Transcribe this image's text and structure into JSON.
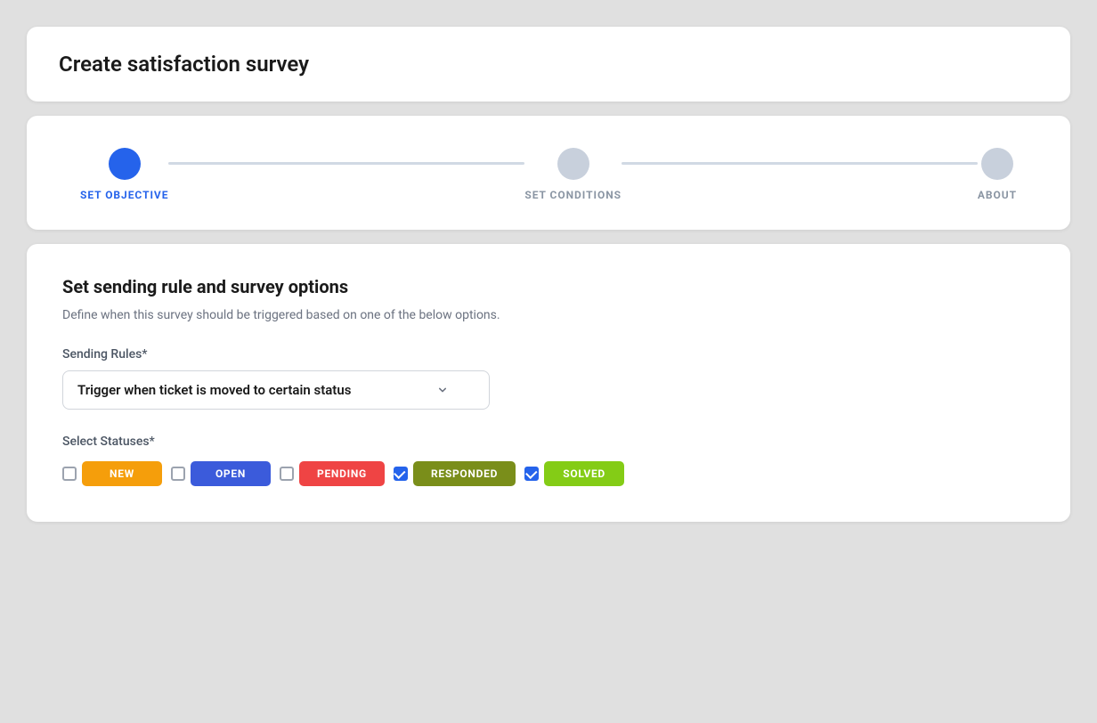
{
  "page": {
    "title": "Create satisfaction survey"
  },
  "stepper": {
    "steps": [
      {
        "id": "set-objective",
        "label": "SET OBJECTIVE",
        "state": "active"
      },
      {
        "id": "set-conditions",
        "label": "SET CONDITIONS",
        "state": "inactive"
      },
      {
        "id": "about",
        "label": "ABOUT",
        "state": "inactive"
      }
    ]
  },
  "form": {
    "section_title": "Set sending rule and survey options",
    "section_description": "Define when this survey should be triggered based on one of the below options.",
    "sending_rules_label": "Sending Rules*",
    "sending_rules_value": "Trigger when ticket is moved to certain status",
    "sending_rules_placeholder": "Trigger when ticket is moved to certain status",
    "select_statuses_label": "Select Statuses*",
    "statuses": [
      {
        "id": "new",
        "label": "NEW",
        "checked": false,
        "color_class": "status-new"
      },
      {
        "id": "open",
        "label": "OPEN",
        "checked": false,
        "color_class": "status-open"
      },
      {
        "id": "pending",
        "label": "PENDING",
        "checked": false,
        "color_class": "status-pending"
      },
      {
        "id": "responded",
        "label": "RESPONDED",
        "checked": true,
        "color_class": "status-responded"
      },
      {
        "id": "solved",
        "label": "SOLVED",
        "checked": true,
        "color_class": "status-solved"
      }
    ]
  },
  "icons": {
    "chevron_down": "▾"
  }
}
